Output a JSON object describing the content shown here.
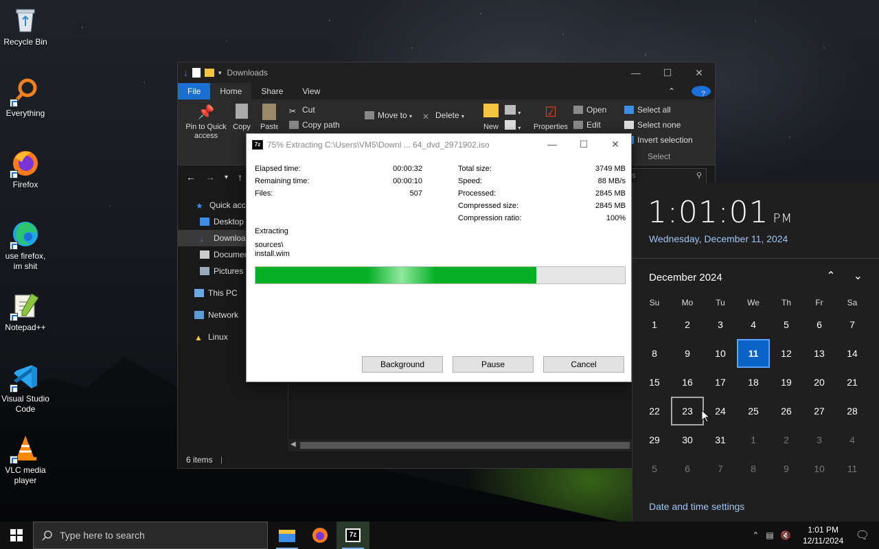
{
  "desktop": {
    "icons": [
      {
        "label": "Recycle Bin"
      },
      {
        "label": "Everything"
      },
      {
        "label": "Firefox"
      },
      {
        "label": "use firefox,\nim shit"
      },
      {
        "label": "Notepad++"
      },
      {
        "label": "Visual Studio Code"
      },
      {
        "label": "VLC media player"
      }
    ]
  },
  "explorer": {
    "title": "Downloads",
    "tabs": {
      "file": "File",
      "home": "Home",
      "share": "Share",
      "view": "View"
    },
    "ribbon": {
      "pin": "Pin to Quick access",
      "copy": "Copy",
      "paste": "Paste",
      "cut": "Cut",
      "copy_path": "Copy path",
      "move_to": "Move to",
      "delete": "Delete",
      "new": "New",
      "properties": "Properties",
      "open": "Open",
      "edit": "Edit",
      "select_all": "Select all",
      "select_none": "Select none",
      "invert_selection": "Invert selection",
      "select_group": "Select"
    },
    "search_placeholder": "ds",
    "sidebar": [
      "Quick access",
      "Desktop",
      "Downloads",
      "Documents",
      "Pictures",
      "This PC",
      "Network",
      "Linux"
    ],
    "status": "6 items"
  },
  "sevenzip": {
    "title": "75% Extracting C:\\Users\\VM5\\Downl ... 64_dvd_2971902.iso",
    "left": [
      {
        "k": "Elapsed time:",
        "v": "00:00:32"
      },
      {
        "k": "Remaining time:",
        "v": "00:00:10"
      },
      {
        "k": "Files:",
        "v": "507"
      }
    ],
    "right": [
      {
        "k": "Total size:",
        "v": "3749 MB"
      },
      {
        "k": "Speed:",
        "v": "88 MB/s"
      },
      {
        "k": "Processed:",
        "v": "2845 MB"
      },
      {
        "k": "Compressed size:",
        "v": "2845 MB"
      },
      {
        "k": "Compression ratio:",
        "v": "100%"
      }
    ],
    "action": "Extracting",
    "current_path": "sources\\",
    "current_file": "install.wim",
    "progress": 0.76,
    "buttons": {
      "background": "Background",
      "pause": "Pause",
      "cancel": "Cancel"
    }
  },
  "calendar": {
    "time": "1:01:01",
    "ampm": "PM",
    "date": "Wednesday, December 11, 2024",
    "month": "December 2024",
    "dow": [
      "Su",
      "Mo",
      "Tu",
      "We",
      "Th",
      "Fr",
      "Sa"
    ],
    "days": [
      "1",
      "2",
      "3",
      "4",
      "5",
      "6",
      "7",
      "8",
      "9",
      "10",
      "11",
      "12",
      "13",
      "14",
      "15",
      "16",
      "17",
      "18",
      "19",
      "20",
      "21",
      "22",
      "23",
      "24",
      "25",
      "26",
      "27",
      "28",
      "29",
      "30",
      "31",
      "1",
      "2",
      "3",
      "4",
      "5",
      "6",
      "7",
      "8",
      "9",
      "10",
      "11"
    ],
    "settings": "Date and time settings"
  },
  "taskbar": {
    "search_placeholder": "Type here to search",
    "time": "1:01 PM",
    "date": "12/11/2024"
  },
  "colors": {
    "accent": "#0a64c8",
    "progress": "#06b025",
    "file_tab": "#1a6fd0"
  }
}
